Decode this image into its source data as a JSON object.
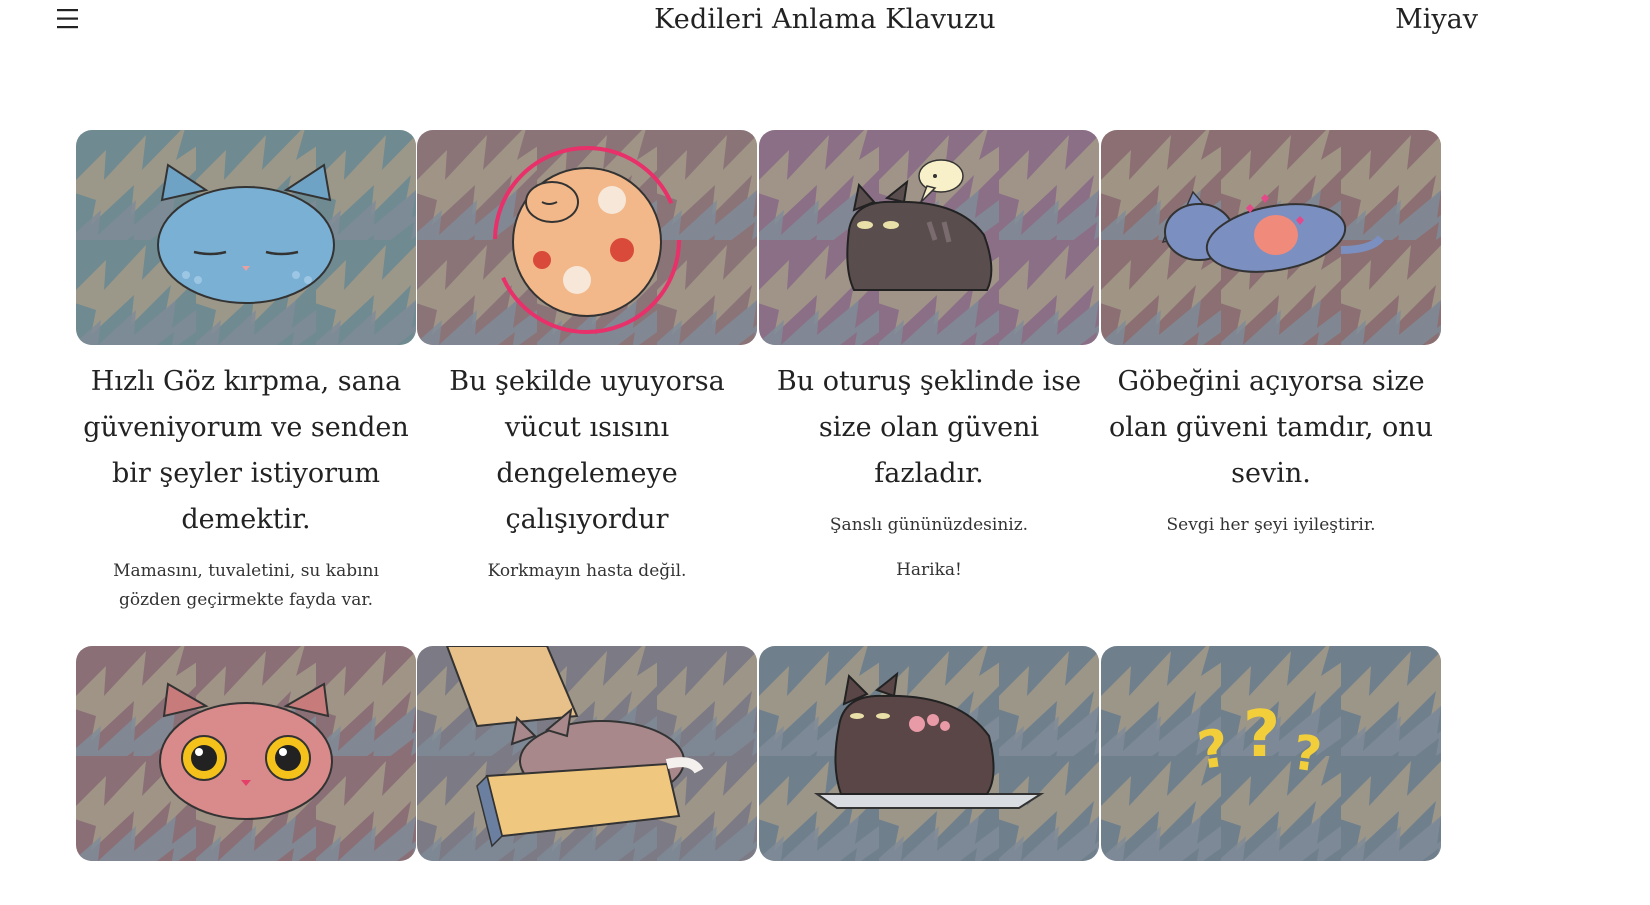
{
  "header": {
    "menu_icon": "hamburger-menu-icon",
    "title": "Kedileri Anlama Klavuzu",
    "nav_link": "Miyav"
  },
  "cards": [
    {
      "heading": "Hızlı Göz kırpma, sana güveniyorum ve senden bir şeyler istiyorum demektir.",
      "note": "Mamasını, tuvaletini, su kabını gözden geçirmekte fayda var.",
      "image": "blue-cat-slow-blink-illustration",
      "bg": "#6f8a90"
    },
    {
      "heading": "Bu şekilde uyuyorsa vücut ısısını dengelemeye çalışıyordur",
      "note": "Korkmayın hasta değil.",
      "image": "curled-orange-cat-sleeping-illustration",
      "bg": "#8a7478"
    },
    {
      "heading": "Bu oturuş şeklinde ise size olan güveni fazladır.",
      "note": "Şanslı gününüzdesiniz.",
      "note2": "Harika!",
      "image": "loaf-cat-with-speech-bubble-illustration",
      "bg": "#8a6f86"
    },
    {
      "heading": "Göbeğini açıyorsa size olan güveni tamdır, onu sevin.",
      "note": "Sevgi her şeyi iyileştirir.",
      "image": "cat-showing-belly-illustration",
      "bg": "#8b6f72"
    },
    {
      "image": "pink-cat-wide-eyes-illustration",
      "bg": "#8a6f76"
    },
    {
      "image": "cat-in-cardboard-box-illustration",
      "bg": "#7c7a84"
    },
    {
      "image": "cat-on-laptop-illustration",
      "bg": "#6f7f8c"
    },
    {
      "image": "question-marks-illustration",
      "bg": "#6f7f8c"
    }
  ],
  "colors": {
    "zigzag_light": "#a39a8a",
    "zigzag_slate": "#7d8a97",
    "text": "#222222"
  }
}
